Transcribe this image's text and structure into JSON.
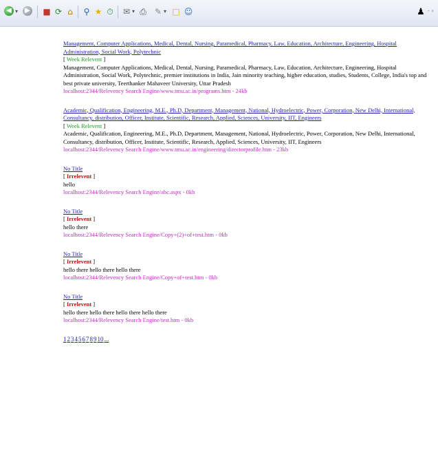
{
  "toolbar": {
    "icons": [
      "back-icon",
      "forward-icon",
      "stop-icon",
      "refresh-icon",
      "home-icon",
      "search-icon",
      "favorites-icon",
      "history-icon",
      "mail-icon",
      "print-icon",
      "edit-icon",
      "messenger-icon"
    ],
    "right_icon": "messenger-people-icon",
    "colors": {
      "back": "#1f8a1f",
      "forward": "#7a8794"
    }
  },
  "results": [
    {
      "title": "Management, Computer Applications, Medical, Dental, Nursing, Paramedical, Pharmacy, Law, Education, Architecture, Engineering, Hospital Administration, Social Work, Polytechnic",
      "relevance": "Week Relevent",
      "snippet": "Management, Computer Applications, Medical, Dental, Nursing, Paramedical, Pharmacy, Law, Education, Architecture, Engineering, Hospital Administration, Social Work, Polytechnic, premier institutions in India, Jain minority teaching, higher education, studies, Students, College, India's top and best private university, Teerthanker Mahaveer University, Uttar Pradesh",
      "url": "localhost:2344/Relevency Search Engine/www.tmu.ac.in/programs.htm - 24kb"
    },
    {
      "title": "Academic, Qualification, Engineering, M.E., Ph.D, Department, Management, National, Hydroelectric, Power, Corporation, New Delhi, International, Consultancy, distribution, Officer, Institute, Scientific, Research, Applied, Sciences, University, IIT, Engineers",
      "relevance": "Week Relevent",
      "snippet": "Academic, Qualification, Engineering, M.E., Ph.D, Department, Management, National, Hydroelectric, Power, Corporation, New Delhi, International, Consultancy, distribution, Officer, Institute, Scientific, Research, Applied, Sciences, University, IIT, Engineers",
      "url": "localhost:2344/Relevency Search Engine/www.tmu.ac.in/engineering/directorprofile.htm - 23kb"
    },
    {
      "title": "No Title",
      "relevance": "Irrelevent",
      "snippet": "hello",
      "url": "localhost:2344/Relevency Search Engine/abc.aspx - 0kb"
    },
    {
      "title": "No Title",
      "relevance": "Irrelevent",
      "snippet": "hello there",
      "url": "localhost:2344/Relevency Search Engine/Copy+(2)+of+test.htm - 0kb"
    },
    {
      "title": "No Title",
      "relevance": "Irrelevent",
      "snippet": "hello there hello there hello there",
      "url": "localhost:2344/Relevency Search Engine/Copy+of+test.htm - 0kb"
    },
    {
      "title": "No Title",
      "relevance": "Irrelevent",
      "snippet": "hello there hello there hello there hello there",
      "url": "localhost:2344/Relevency Search Engine/test.htm - 0kb"
    }
  ],
  "pagination": {
    "pages": [
      "1",
      "2",
      "3",
      "4",
      "5",
      "6",
      "7",
      "8",
      "9",
      "10",
      "..."
    ]
  }
}
